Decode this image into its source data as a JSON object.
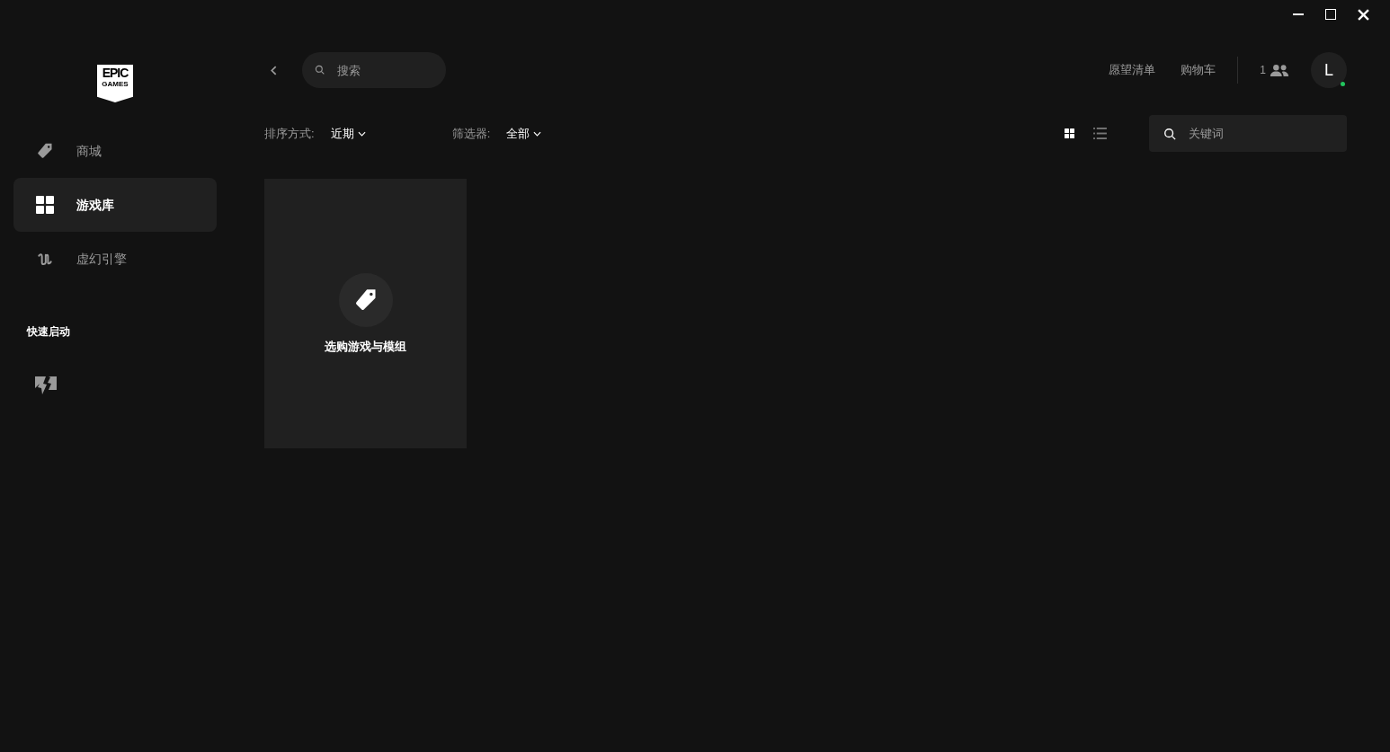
{
  "logo": {
    "top": "EPIC",
    "bottom": "GAMES"
  },
  "sidebar": {
    "items": [
      {
        "label": "商城",
        "kind": "tag",
        "selected": false
      },
      {
        "label": "游戏库",
        "kind": "grid",
        "selected": true
      },
      {
        "label": "虚幻引擎",
        "kind": "unreal",
        "selected": false
      }
    ],
    "quick_launch": {
      "title": "快速启动"
    }
  },
  "top_bar": {
    "search": {
      "placeholder": "搜索"
    },
    "links": [
      "愿望清单",
      "购物车"
    ],
    "friends_count": "1",
    "avatar": {
      "initial": "L",
      "online": true
    }
  },
  "filters": {
    "sort_label": "排序方式:",
    "sort_value": "近期",
    "filter_label": "筛选器:",
    "filter_value": "全部",
    "views": [
      {
        "kind": "grid",
        "selected": true
      },
      {
        "kind": "list",
        "selected": false
      }
    ],
    "keyword": {
      "placeholder": "关键词"
    }
  },
  "cards": [
    {
      "label": "选购游戏与模组"
    }
  ]
}
